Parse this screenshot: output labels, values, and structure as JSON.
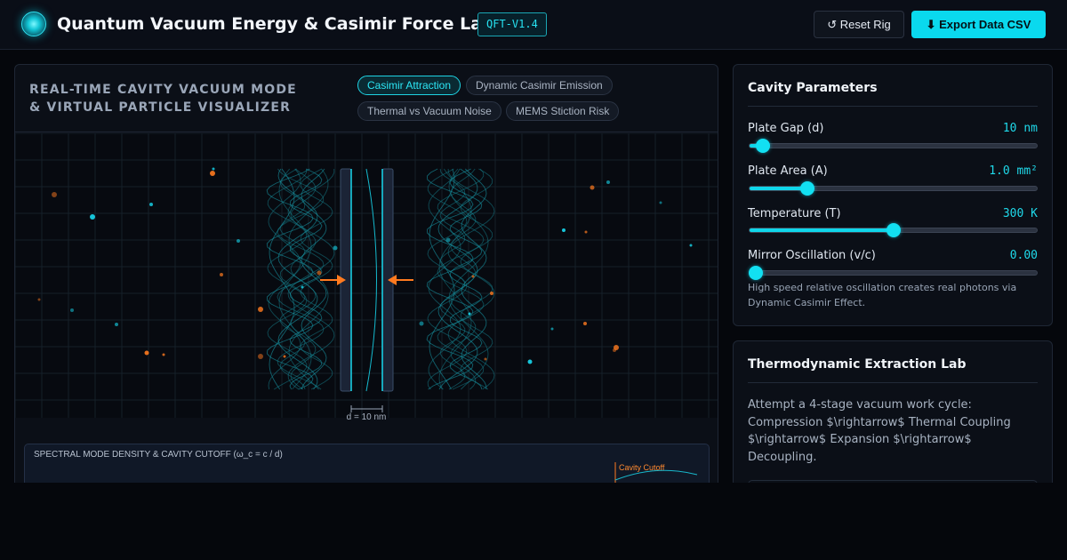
{
  "header": {
    "title": "Quantum Vacuum Energy & Casimir Force Lab",
    "version": "QFT-V1.4",
    "reset_label": "↺ Reset Rig",
    "export_label": "⬇ Export Data CSV"
  },
  "visualizer": {
    "title": "REAL-TIME CAVITY VACUUM MODE & VIRTUAL PARTICLE VISUALIZER",
    "modes": [
      {
        "label": "Casimir Attraction",
        "active": true
      },
      {
        "label": "Dynamic Casimir Emission",
        "active": false
      },
      {
        "label": "Thermal vs Vacuum Noise",
        "active": false
      },
      {
        "label": "MEMS Stiction Risk",
        "active": false
      }
    ],
    "gap_label": "d = 10 nm",
    "spectral_title": "SPECTRAL MODE DENSITY & CAVITY CUTOFF (ω_c = c / d)",
    "cutoff_label": "Cavity Cutoff"
  },
  "parameters": {
    "title": "Cavity Parameters",
    "items": [
      {
        "label": "Plate Gap (d)",
        "value": "10 nm",
        "fraction": 0.045
      },
      {
        "label": "Plate Area (A)",
        "value": "1.0 mm²",
        "fraction": 0.2
      },
      {
        "label": "Temperature (T)",
        "value": "300 K",
        "fraction": 0.5
      },
      {
        "label": "Mirror Oscillation (v/c)",
        "value": "0.00",
        "fraction": 0.0
      }
    ],
    "hint": "High speed relative oscillation creates real photons via Dynamic Casimir Effect."
  },
  "thermo": {
    "title": "Thermodynamic Extraction Lab",
    "description": "Attempt a 4-stage vacuum work cycle: Compression $\\rightarrow$ Thermal Coupling $\\rightarrow$ Expansion $\\rightarrow$ Decoupling."
  },
  "colors": {
    "accent": "#0ad9ee",
    "particle_orange": "#ff7a1f",
    "particle_cyan": "#18d8ee"
  }
}
